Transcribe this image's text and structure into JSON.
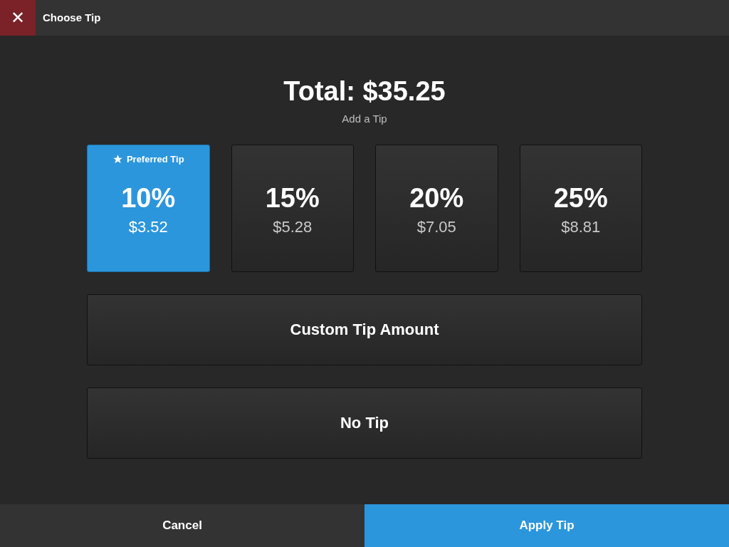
{
  "header": {
    "close_icon": "✕",
    "title": "Choose Tip"
  },
  "total": "Total: $35.25",
  "subtitle": "Add a Tip",
  "tips": [
    {
      "percent": "10%",
      "amount": "$3.52",
      "selected": true,
      "badge": "Preferred Tip"
    },
    {
      "percent": "15%",
      "amount": "$5.28",
      "selected": false
    },
    {
      "percent": "20%",
      "amount": "$7.05",
      "selected": false
    },
    {
      "percent": "25%",
      "amount": "$8.81",
      "selected": false
    }
  ],
  "options": [
    "Custom Tip Amount",
    "No Tip"
  ],
  "footer": {
    "cancel": "Cancel",
    "apply": "Apply Tip"
  }
}
